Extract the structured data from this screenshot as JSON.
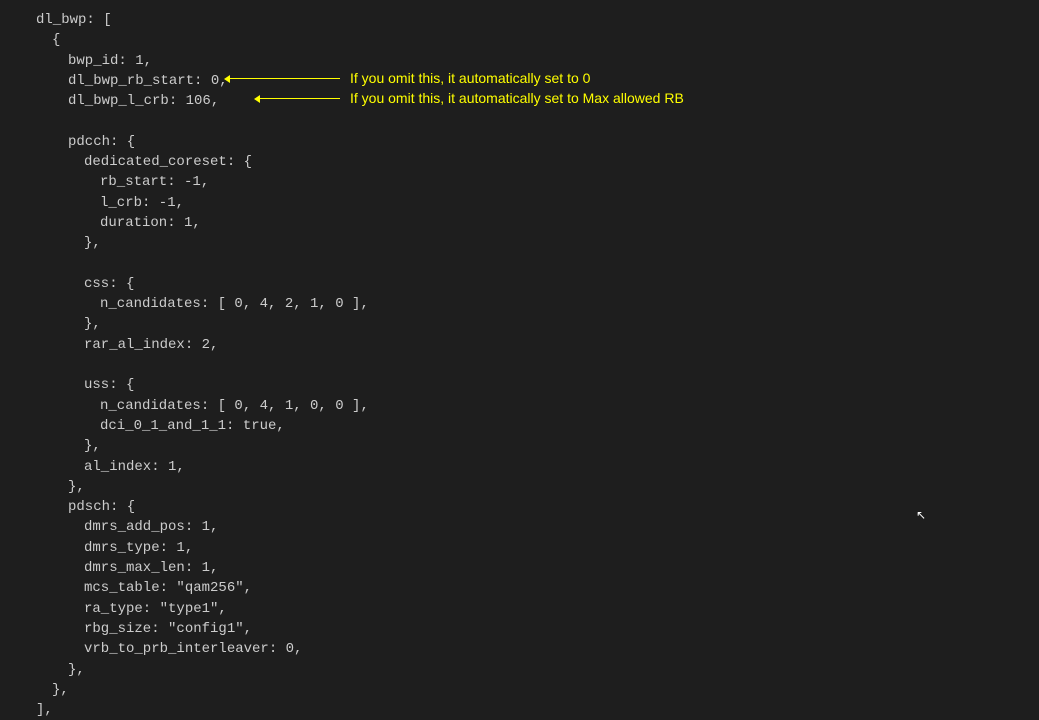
{
  "code": {
    "dl_bwp_open": "dl_bwp: [",
    "brace_open": "{",
    "bwp_id": "bwp_id: 1,",
    "dl_bwp_rb_start": "dl_bwp_rb_start: 0,",
    "dl_bwp_l_crb": "dl_bwp_l_crb: 106,",
    "pdcch_open": "pdcch: {",
    "dedicated_coreset_open": "dedicated_coreset: {",
    "rb_start": "rb_start: -1,",
    "l_crb": "l_crb: -1,",
    "duration": "duration: 1,",
    "dedicated_coreset_close": "},",
    "css_open": "css: {",
    "css_n_candidates": "n_candidates: [ 0, 4, 2, 1, 0 ],",
    "css_close": "},",
    "rar_al_index": "rar_al_index: 2,",
    "uss_open": "uss: {",
    "uss_n_candidates": "n_candidates: [ 0, 4, 1, 0, 0 ],",
    "dci_0_1_and_1_1": "dci_0_1_and_1_1: true,",
    "uss_close": "},",
    "al_index": "al_index: 1,",
    "pdcch_close": "},",
    "pdsch_open": "pdsch: {",
    "dmrs_add_pos": "dmrs_add_pos: 1,",
    "dmrs_type": "dmrs_type: 1,",
    "dmrs_max_len": "dmrs_max_len: 1,",
    "mcs_table": "mcs_table: \"qam256\",",
    "ra_type": "ra_type: \"type1\",",
    "rbg_size": "rbg_size: \"config1\",",
    "vrb_to_prb_interleaver": "vrb_to_prb_interleaver: 0,",
    "pdsch_close": "},",
    "brace_close": "},",
    "dl_bwp_close": "],"
  },
  "annotations": {
    "rb_start_note": "If you omit this, it automatically set to 0",
    "l_crb_note": "If you omit this, it automatically set to Max allowed RB"
  }
}
